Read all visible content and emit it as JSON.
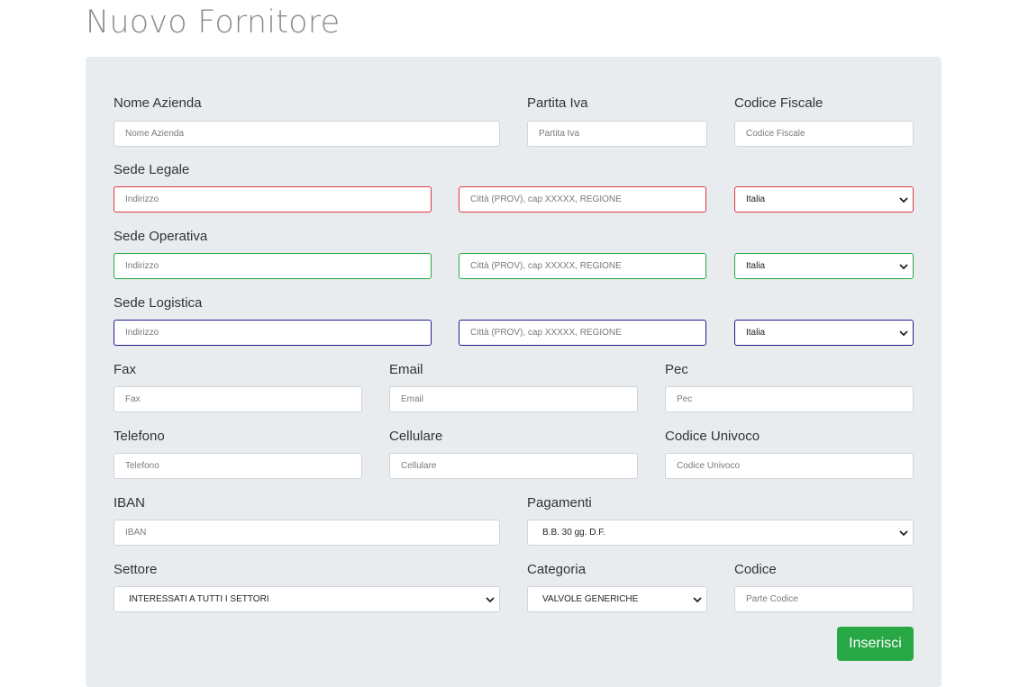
{
  "page": {
    "title": "Nuovo Fornitore"
  },
  "colors": {
    "sede_legale_border": "#dc3545",
    "sede_operativa_border": "#28a745",
    "sede_logistica_border": "#1b1f8c",
    "submit": "#28a745",
    "card_bg": "#e9ecef"
  },
  "azienda": {
    "nome_label": "Nome Azienda",
    "nome_placeholder": "Nome Azienda",
    "piva_label": "Partita Iva",
    "piva_placeholder": "Partita Iva",
    "cf_label": "Codice Fiscale",
    "cf_placeholder": "Codice Fiscale"
  },
  "sede_legale": {
    "label": "Sede Legale",
    "indirizzo_placeholder": "Indirizzo",
    "citta_placeholder": "Città (PROV), cap XXXXX, REGIONE",
    "paese_selected": "Italia"
  },
  "sede_operativa": {
    "label": "Sede Operativa",
    "indirizzo_placeholder": "Indirizzo",
    "citta_placeholder": "Città (PROV), cap XXXXX, REGIONE",
    "paese_selected": "Italia"
  },
  "sede_logistica": {
    "label": "Sede Logistica",
    "indirizzo_placeholder": "Indirizzo",
    "citta_placeholder": "Città (PROV), cap XXXXX, REGIONE",
    "paese_selected": "Italia"
  },
  "contatti": {
    "fax_label": "Fax",
    "fax_placeholder": "Fax",
    "email_label": "Email",
    "email_placeholder": "Email",
    "pec_label": "Pec",
    "pec_placeholder": "Pec",
    "telefono_label": "Telefono",
    "telefono_placeholder": "Telefono",
    "cellulare_label": "Cellulare",
    "cellulare_placeholder": "Cellulare",
    "codice_univoco_label": "Codice Univoco",
    "codice_univoco_placeholder": "Codice Univoco"
  },
  "pagamento": {
    "iban_label": "IBAN",
    "iban_placeholder": "IBAN",
    "pagamenti_label": "Pagamenti",
    "pagamenti_selected": "B.B. 30 gg. D.F."
  },
  "classificazione": {
    "settore_label": "Settore",
    "settore_selected": "INTERESSATI A TUTTI I SETTORI",
    "categoria_label": "Categoria",
    "categoria_selected": "VALVOLE GENERICHE",
    "codice_label": "Codice",
    "codice_placeholder": "Parte Codice"
  },
  "actions": {
    "submit_label": "Inserisci"
  }
}
